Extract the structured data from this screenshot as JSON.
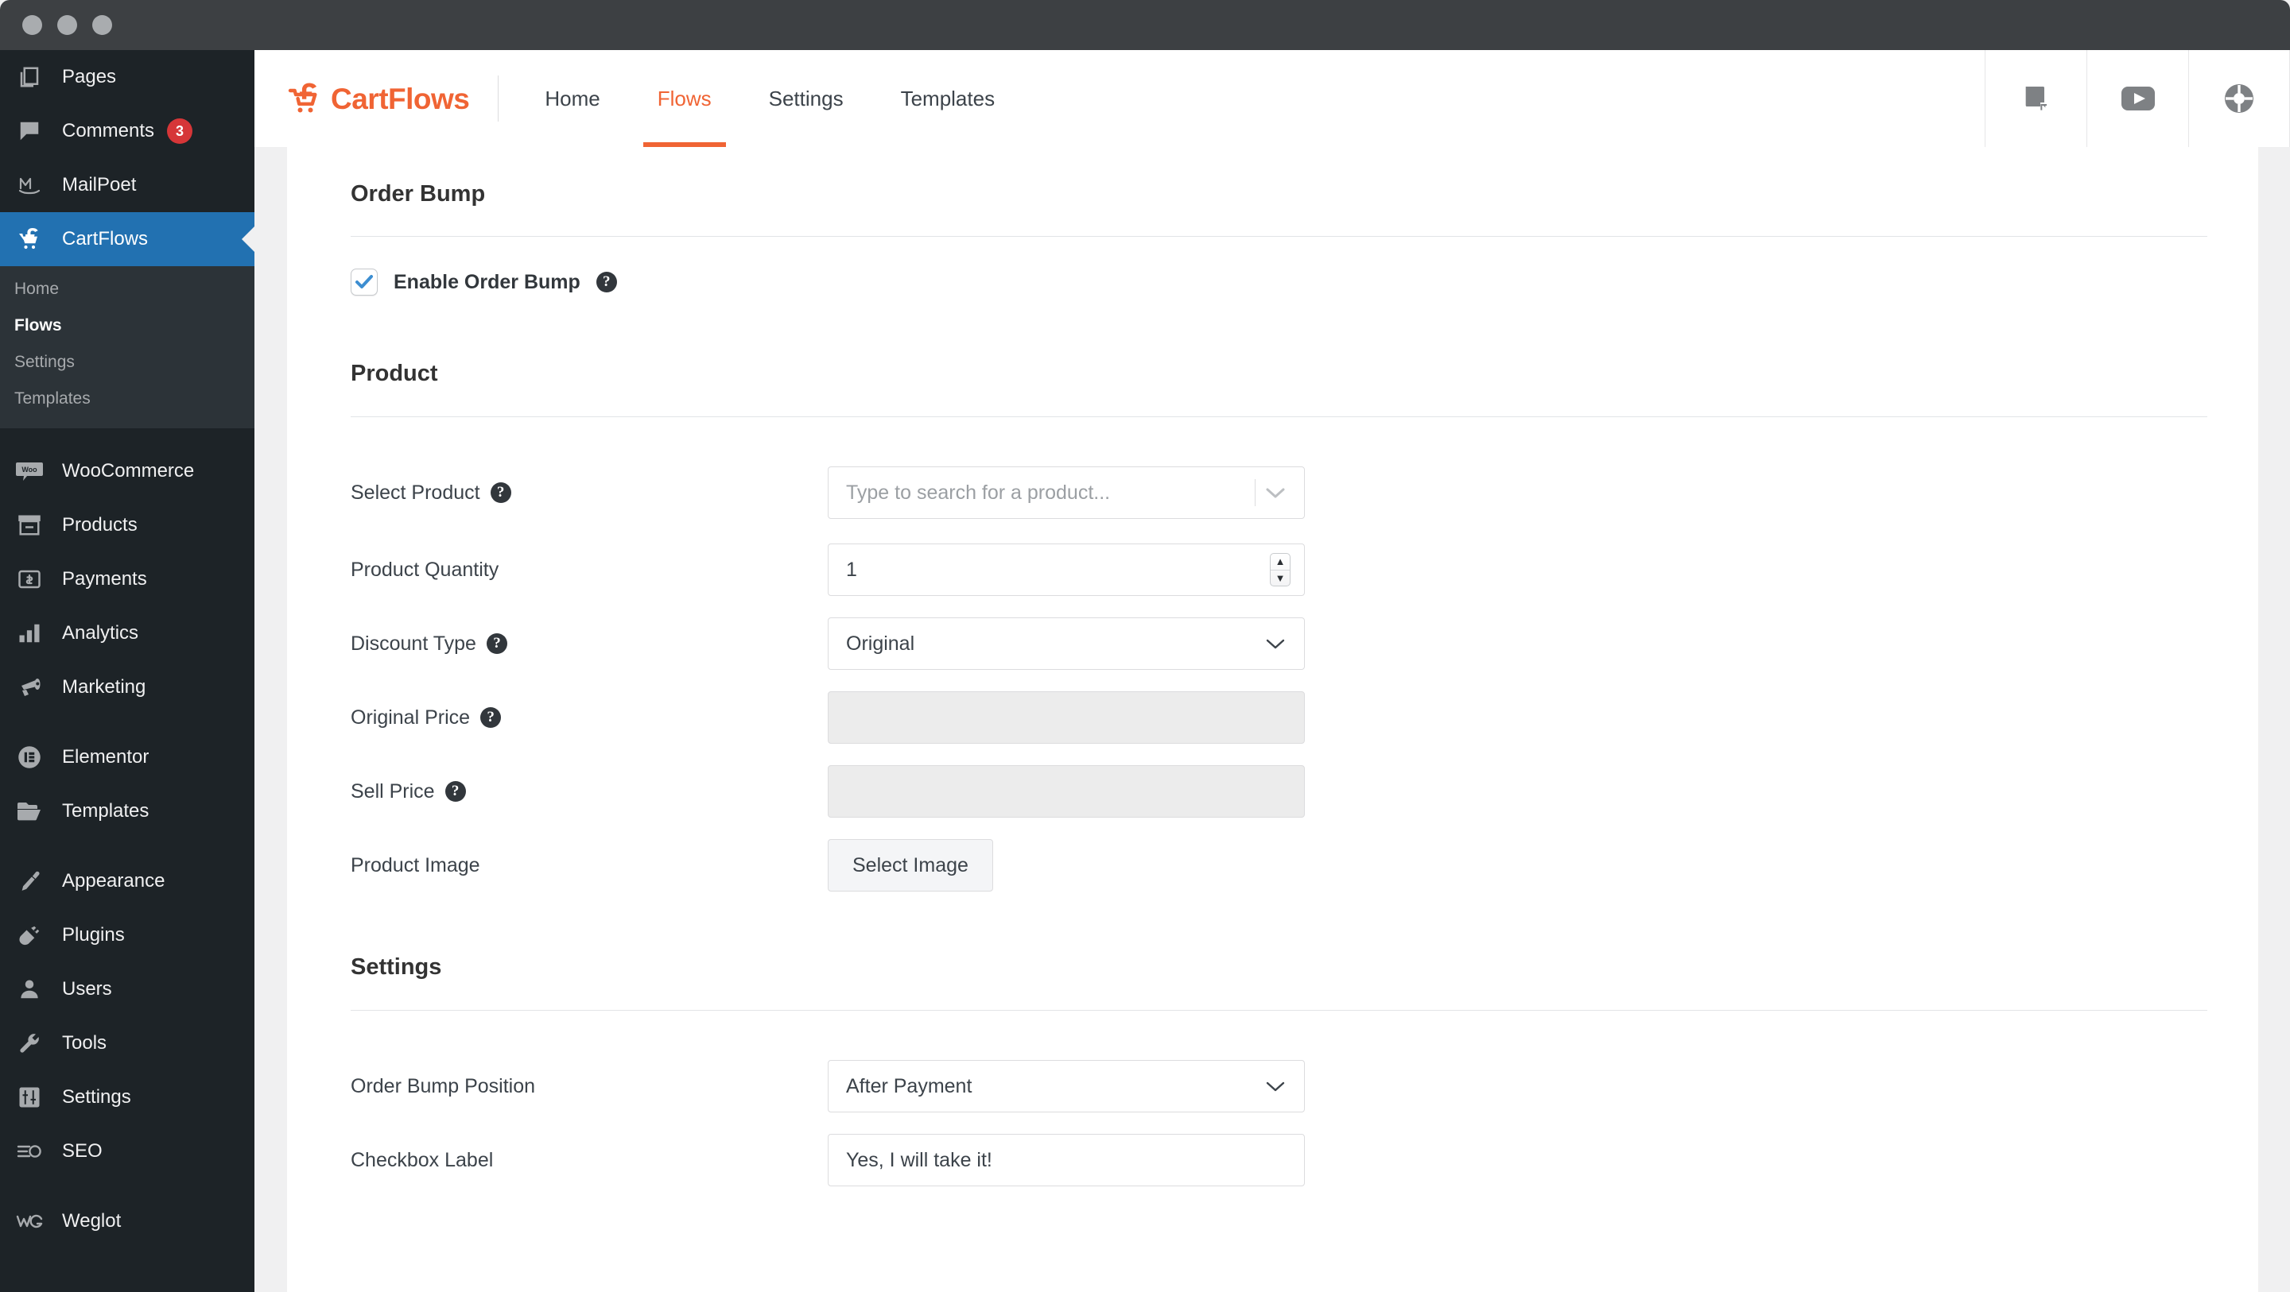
{
  "window": {
    "traffic_lights": [
      "close",
      "minimize",
      "maximize"
    ]
  },
  "sidebar": {
    "items": [
      {
        "label": "Pages",
        "icon": "pages-icon",
        "active": false
      },
      {
        "label": "Comments",
        "icon": "comments-icon",
        "badge": "3",
        "active": false
      },
      {
        "label": "MailPoet",
        "icon": "mailpoet-icon",
        "active": false
      },
      {
        "label": "CartFlows",
        "icon": "cartflows-icon",
        "active": true
      },
      {
        "label": "WooCommerce",
        "icon": "woocommerce-icon",
        "active": false
      },
      {
        "label": "Products",
        "icon": "products-icon",
        "active": false
      },
      {
        "label": "Payments",
        "icon": "payments-icon",
        "active": false
      },
      {
        "label": "Analytics",
        "icon": "analytics-icon",
        "active": false
      },
      {
        "label": "Marketing",
        "icon": "marketing-icon",
        "active": false
      },
      {
        "label": "Elementor",
        "icon": "elementor-icon",
        "active": false
      },
      {
        "label": "Templates",
        "icon": "templates-icon",
        "active": false
      },
      {
        "label": "Appearance",
        "icon": "appearance-icon",
        "active": false
      },
      {
        "label": "Plugins",
        "icon": "plugins-icon",
        "active": false
      },
      {
        "label": "Users",
        "icon": "users-icon",
        "active": false
      },
      {
        "label": "Tools",
        "icon": "tools-icon",
        "active": false
      },
      {
        "label": "Settings",
        "icon": "settings-icon",
        "active": false
      },
      {
        "label": "SEO",
        "icon": "seo-icon",
        "active": false
      },
      {
        "label": "Weglot",
        "icon": "weglot-icon",
        "active": false
      }
    ],
    "submenu": [
      {
        "label": "Home",
        "current": false
      },
      {
        "label": "Flows",
        "current": true
      },
      {
        "label": "Settings",
        "current": false
      },
      {
        "label": "Templates",
        "current": false
      }
    ]
  },
  "header": {
    "brand": "CartFlows",
    "brand_color": "#f06434",
    "nav": [
      {
        "label": "Home",
        "active": false
      },
      {
        "label": "Flows",
        "active": true
      },
      {
        "label": "Settings",
        "active": false
      },
      {
        "label": "Templates",
        "active": false
      }
    ],
    "actions": [
      {
        "icon": "documentation-book-icon"
      },
      {
        "icon": "video-play-icon"
      },
      {
        "icon": "support-lifebuoy-icon"
      }
    ]
  },
  "main": {
    "order_bump": {
      "title": "Order Bump",
      "enable_label": "Enable Order Bump",
      "enable_checked": true,
      "enable_help": "?"
    },
    "product_section": {
      "title": "Product",
      "fields": {
        "select_product": {
          "label": "Select Product",
          "help": "?",
          "placeholder": "Type to search for a product...",
          "value": ""
        },
        "product_quantity": {
          "label": "Product Quantity",
          "value": "1"
        },
        "discount_type": {
          "label": "Discount Type",
          "help": "?",
          "value": "Original"
        },
        "original_price": {
          "label": "Original Price",
          "help": "?",
          "value": "",
          "disabled": true
        },
        "sell_price": {
          "label": "Sell Price",
          "help": "?",
          "value": "",
          "disabled": true
        },
        "product_image": {
          "label": "Product Image",
          "button_label": "Select Image"
        }
      }
    },
    "settings_section": {
      "title": "Settings",
      "fields": {
        "order_bump_position": {
          "label": "Order Bump Position",
          "value": "After Payment"
        },
        "checkbox_label": {
          "label": "Checkbox Label",
          "value": "Yes, I will take it!"
        }
      }
    }
  }
}
